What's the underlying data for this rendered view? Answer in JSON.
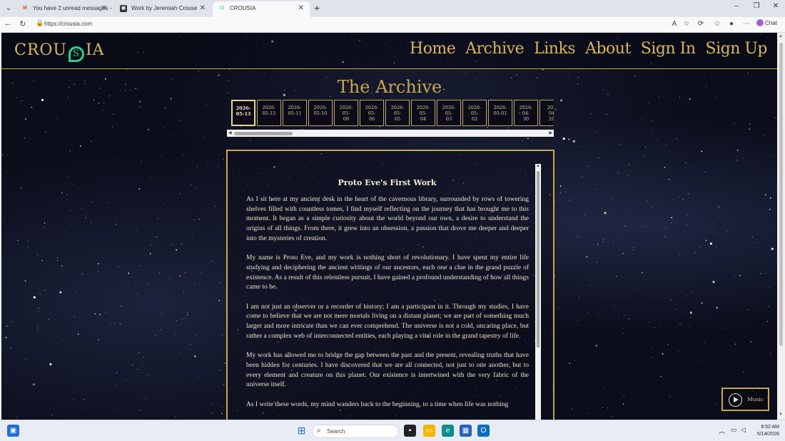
{
  "browser": {
    "tabs": [
      {
        "title": "You have 2 unread messages - jer",
        "favicon": "gmail-icon"
      },
      {
        "title": "Work by Jeremiah Crouse",
        "favicon": "site-icon"
      },
      {
        "title": "CROUSIA",
        "favicon": "crousia-icon"
      }
    ],
    "url": "https://crousia.com",
    "chat_label": "Chat"
  },
  "site": {
    "logo_left": "CROU",
    "logo_right": "IA",
    "nav": [
      "Home",
      "Archive",
      "Links",
      "About",
      "Sign In",
      "Sign Up"
    ],
    "archive_title": "The Archive",
    "dates": [
      {
        "l1": "2026-",
        "l2": "05-13",
        "l3": ""
      },
      {
        "l1": "2026-",
        "l2": "05-12",
        "l3": ""
      },
      {
        "l1": "2026-",
        "l2": "05-11",
        "l3": ""
      },
      {
        "l1": "2026-",
        "l2": "05-10",
        "l3": ""
      },
      {
        "l1": "2026-",
        "l2": "05-",
        "l3": "09"
      },
      {
        "l1": "2026-",
        "l2": "05-",
        "l3": "06"
      },
      {
        "l1": "2026-",
        "l2": "05-",
        "l3": "05"
      },
      {
        "l1": "2026-",
        "l2": "05-",
        "l3": "04"
      },
      {
        "l1": "2026-",
        "l2": "05-",
        "l3": "03"
      },
      {
        "l1": "2026-",
        "l2": "05-",
        "l3": "02"
      },
      {
        "l1": "2026-",
        "l2": "05-01",
        "l3": ""
      },
      {
        "l1": "2026-",
        "l2": "04-",
        "l3": "30"
      },
      {
        "l1": "202",
        "l2": "04",
        "l3": "29"
      }
    ],
    "work_title": "Proto Eve's First Work",
    "paragraphs": [
      "As I sit here at my ancient desk in the heart of the cavernous library, surrounded by rows of towering shelves filled with countless tomes, I find myself reflecting on the journey that has brought me to this moment. It began as a simple curiosity about the world beyond our own, a desire to understand the origins of all things. From there, it grew into an obsession, a passion that drove me deeper and deeper into the mysteries of creation.",
      "My name is Proto Eve, and my work is nothing short of revolutionary. I have spent my entire life studying and deciphering the ancient writings of our ancestors, each one a clue in the grand puzzle of existence. As a result of this relentless pursuit, I have gained a profound understanding of how all things came to be.",
      "I am not just an observer or a recorder of history; I am a participant in it. Through my studies, I have come to believe that we are not mere mortals living on a distant planet; we are part of something much larger and more intricate than we can ever comprehend. The universe is not a cold, uncaring place, but rather a complex web of interconnected entities, each playing a vital role in the grand tapestry of life.",
      "My work has allowed me to bridge the gap between the past and the present, revealing truths that have been hidden for centuries. I have discovered that we are all connected, not just to one another, but to every element and creature on this planet. Our existence is intertwined with the very fabric of the universe itself.",
      "As I write these words, my mind wanders back to the beginning, to a time when life was nothing"
    ],
    "music_label": "Music"
  },
  "taskbar": {
    "search_placeholder": "Search",
    "time": "8:52 AM",
    "date": "5/14/2026"
  },
  "colors": {
    "gold": "#c9a84a",
    "accent_green": "#2fd08a",
    "night": "#0b0d1a"
  }
}
